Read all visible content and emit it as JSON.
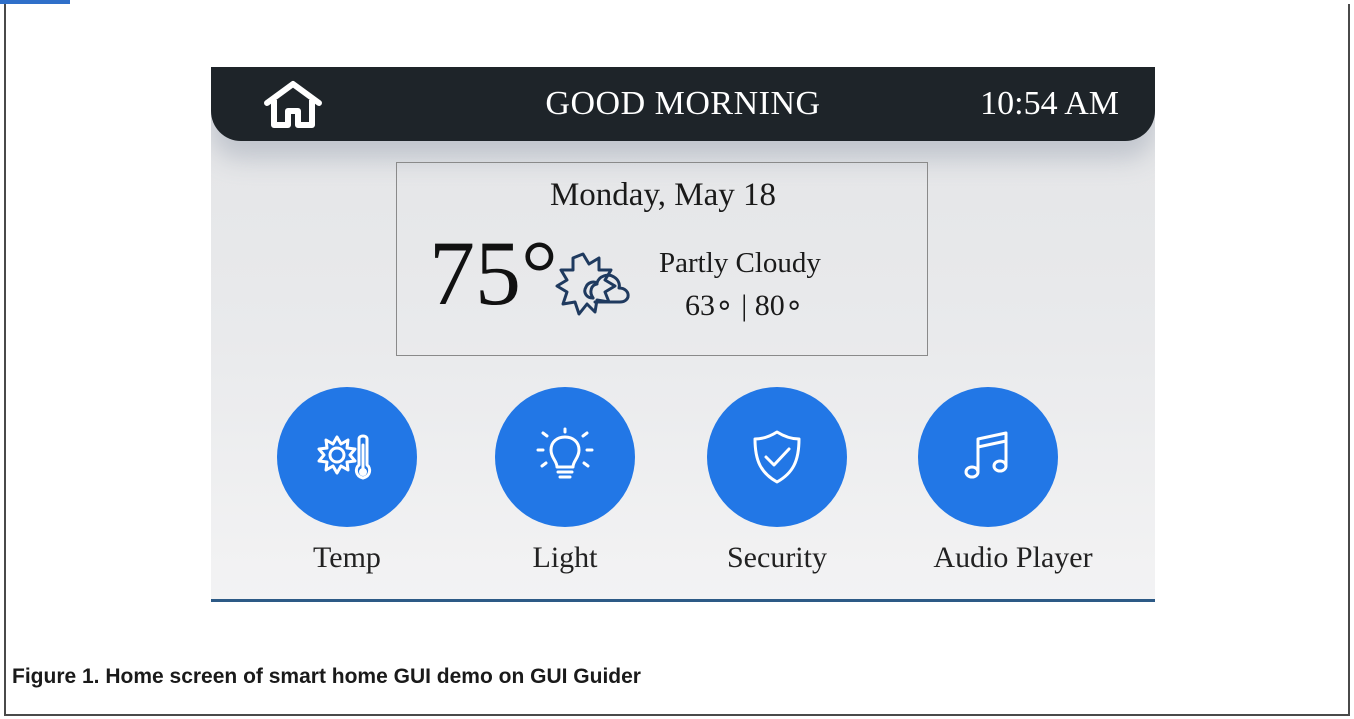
{
  "header": {
    "greeting": "GOOD MORNING",
    "time": "10:54 AM"
  },
  "weather": {
    "date": "Monday, May 18",
    "temperature": "75°",
    "condition": "Partly Cloudy",
    "range": "63∘ | 80∘"
  },
  "apps": [
    {
      "label": "Temp",
      "icon": "sun-thermometer-icon"
    },
    {
      "label": "Light",
      "icon": "lightbulb-icon"
    },
    {
      "label": "Security",
      "icon": "shield-check-icon"
    },
    {
      "label": "Audio Player",
      "icon": "music-note-icon"
    }
  ],
  "colors": {
    "topbar": "#1e2429",
    "button": "#2277e6",
    "divider": "#2d5a86"
  },
  "figure": {
    "caption": "Figure 1.  Home screen of smart home GUI demo on GUI Guider"
  }
}
